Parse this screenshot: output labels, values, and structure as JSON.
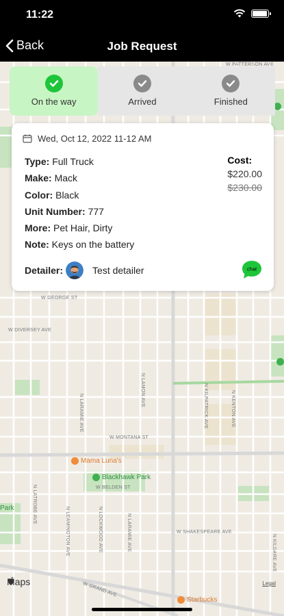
{
  "status_bar": {
    "time": "11:22"
  },
  "nav": {
    "back_label": "Back",
    "title": "Job Request"
  },
  "steps": [
    {
      "label": "On the way",
      "active": true,
      "color": "#1ec53a"
    },
    {
      "label": "Arrived",
      "active": false,
      "color": "#8a8a8a"
    },
    {
      "label": "Finished",
      "active": false,
      "color": "#8a8a8a"
    }
  ],
  "job": {
    "date": "Wed, Oct 12, 2022 11-12 AM",
    "fields": [
      {
        "label": "Type:",
        "value": "Full Truck"
      },
      {
        "label": "Make:",
        "value": "Mack"
      },
      {
        "label": "Color:",
        "value": "Black"
      },
      {
        "label": "Unit Number:",
        "value": "777"
      },
      {
        "label": "More:",
        "value": "Pet Hair, Dirty"
      },
      {
        "label": "Note:",
        "value": "Keys on the battery"
      }
    ],
    "cost_label": "Cost:",
    "cost": "$220.00",
    "original_cost": "$230.00",
    "detailer_label": "Detailer:",
    "detailer_name": "Test detailer",
    "chat_label": "chat"
  },
  "map": {
    "brand": "Maps",
    "legal": "Legal",
    "streets": {
      "patterson": "W PATTERSON AVE",
      "george": "W GEORGE ST",
      "diversey": "W DIVERSEY AVE",
      "montana": "W MONTANA ST",
      "belden": "W BELDEN ST",
      "shakespeare": "W SHAKESPEARE AVE",
      "grand": "W GRAND AVE",
      "lamon": "N LAMON AVE",
      "laramie": "N LARAMIE AVE",
      "kilpatrick": "N KILPATRICK AVE",
      "kenton": "N KENTON AVE",
      "latrobe": "N LATROBE AVE",
      "leamington": "N LEAMINGTON AVE",
      "lockwood": "N LOCKWOOD AVE",
      "kildare": "N KILDARE AVE"
    },
    "pois": {
      "mama_lunas": "Mama Luna's",
      "blackhawk": "Blackhawk Park",
      "park": "Park",
      "starbucks": "Starbucks"
    },
    "colors": {
      "food": "#f28c38",
      "park": "#3fb04f",
      "park_area": "#b9dfb0"
    }
  }
}
